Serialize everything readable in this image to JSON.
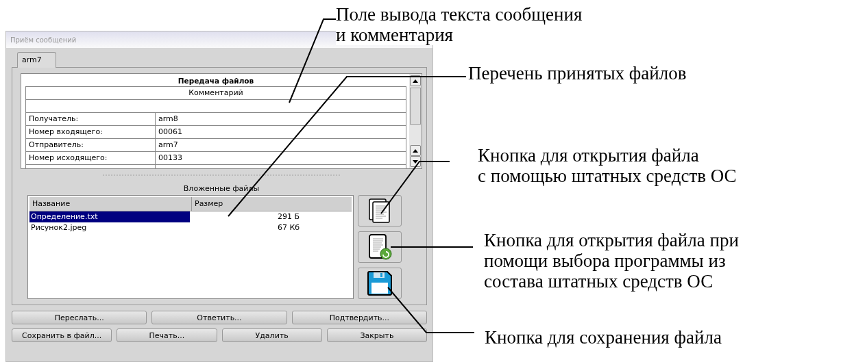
{
  "window": {
    "title": "Приём сообщений"
  },
  "tabs": [
    {
      "label": "arm7",
      "selected": true
    }
  ],
  "message": {
    "title": "Передача файлов",
    "comment_header": "Комментарий",
    "rows": [
      {
        "label": "Получатель:",
        "value": "arm8"
      },
      {
        "label": "Номер входящего:",
        "value": "00061"
      },
      {
        "label": "Отправитель:",
        "value": "arm7"
      },
      {
        "label": "Номер исходящего:",
        "value": "00133"
      }
    ]
  },
  "attachments": {
    "title": "Вложенные файлы",
    "columns": [
      "Название",
      "Размер"
    ],
    "rows": [
      {
        "name": "Определение.txt",
        "size": "291 Б",
        "selected": true
      },
      {
        "name": "Рисунок2.jpeg",
        "size": "67 Кб",
        "selected": false
      }
    ]
  },
  "button_rows": [
    [
      "Переслать...",
      "Ответить...",
      "Подтвердить..."
    ],
    [
      "Сохранить в файл...",
      "Печать...",
      "Удалить",
      "Закрыть"
    ]
  ],
  "annotations": [
    {
      "lines": [
        "Поле вывода текста сообщения",
        "и комментария"
      ]
    },
    {
      "lines": [
        "Перечень принятых файлов"
      ]
    },
    {
      "lines": [
        "Кнопка для открытия файла",
        "с помощью штатных средств ОС"
      ]
    },
    {
      "lines": [
        "Кнопка для открытия файла при",
        "помощи выбора программы из",
        "состава штатных средств ОС"
      ]
    },
    {
      "lines": [
        "Кнопка для  сохранения файла"
      ]
    }
  ]
}
